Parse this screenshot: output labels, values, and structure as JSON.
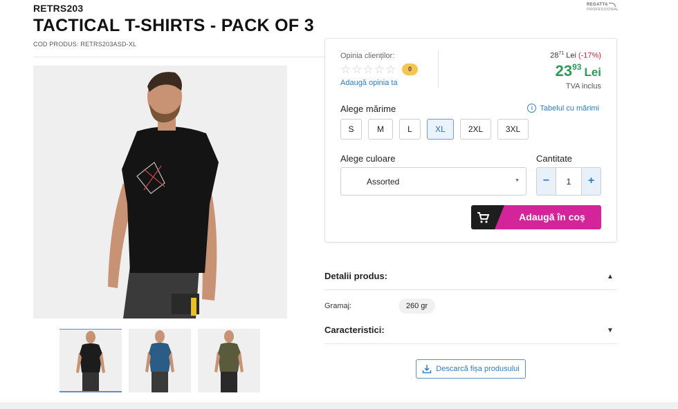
{
  "brand": {
    "code": "RETRS203",
    "logo_top": "REGATTA",
    "logo_bottom": "PROFESSIONAL"
  },
  "product": {
    "title": "TACTICAL T-SHIRTS - PACK OF 3",
    "sku": "COD PRODUS: RETRS203ASD-XL",
    "image_alt": "Black tactical t-shirt worn by model",
    "thumbnails": [
      {
        "name": "black",
        "color": "#1c1c1c"
      },
      {
        "name": "navy",
        "color": "#2b5c86"
      },
      {
        "name": "olive",
        "color": "#5a5a3c"
      }
    ]
  },
  "reviews": {
    "label": "Opinia clienților:",
    "count": "0",
    "stars_filled": 0,
    "stars_total": 5,
    "add_link": "Adaugă opinia ta"
  },
  "pricing": {
    "old_int": "28",
    "old_dec": "71",
    "old_currency": "Lei",
    "discount": "(-17%)",
    "int": "23",
    "dec": "93",
    "currency": "Lei",
    "vat": "TVA inclus",
    "accent_color": "#2e9a5a"
  },
  "size": {
    "label": "Alege mărime",
    "guide_link": "Tabelul cu mărimi",
    "options": [
      "S",
      "M",
      "L",
      "XL",
      "2XL",
      "3XL"
    ],
    "selected": "XL"
  },
  "color": {
    "label": "Alege culoare",
    "selected": "Assorted"
  },
  "quantity": {
    "label": "Cantitate",
    "value": "1",
    "minus": "−",
    "plus": "+"
  },
  "cart": {
    "label": "Adaugă în coș",
    "brand_color": "#d4249a"
  },
  "details": {
    "title": "Detalii produs:",
    "rows": [
      {
        "label": "Gramaj:",
        "value": "260 gr"
      }
    ]
  },
  "characteristics": {
    "title": "Caracteristici:"
  },
  "download": {
    "label": "Descarcă fișa produsului"
  }
}
